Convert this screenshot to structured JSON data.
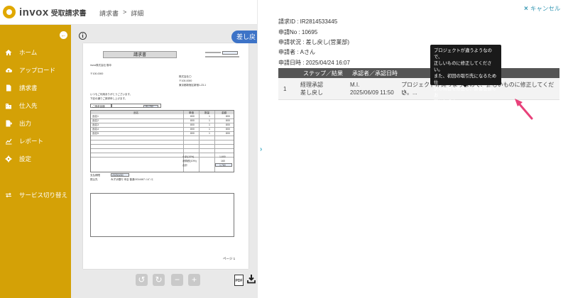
{
  "app": {
    "logo_text": "invox",
    "logo_sub": "受取請求書",
    "breadcrumb": [
      "請求書",
      ">",
      "詳細"
    ]
  },
  "sidebar": {
    "collapse_icon": "arrow-left-circle-icon",
    "items": [
      {
        "label": "ホーム",
        "icon": "home-icon"
      },
      {
        "label": "アップロード",
        "icon": "cloud-upload-icon"
      },
      {
        "label": "請求書",
        "icon": "document-icon"
      },
      {
        "label": "仕入先",
        "icon": "building-icon"
      },
      {
        "label": "出力",
        "icon": "export-icon"
      },
      {
        "label": "レポート",
        "icon": "chart-icon"
      },
      {
        "label": "設定",
        "icon": "gear-icon"
      },
      {
        "label": "サービス切り替え",
        "icon": "switch-icon"
      }
    ]
  },
  "viewer": {
    "return_button": "差し戻し",
    "document": {
      "title": "請求書",
      "recipient": "invox株式会社 御中",
      "postal": "〒100-0000",
      "greeting1": "いつもご利用ありがとうございます。",
      "greeting2": "下記の通りご請求申し上げます。",
      "amount_label": "ご請求金額",
      "amount_value": "¥1,760",
      "col_item": "品名",
      "col_price": "単価",
      "col_qty": "数量",
      "col_amount": "金額",
      "rows": [
        {
          "name": "品名1",
          "price": "800",
          "qty": "1",
          "amount": "800"
        },
        {
          "name": "品名2",
          "price": "800",
          "qty": "1",
          "amount": "800"
        },
        {
          "name": "品名3",
          "price": "800",
          "qty": "1",
          "amount": "800"
        },
        {
          "name": "品名4",
          "price": "800",
          "qty": "1",
          "amount": "800"
        },
        {
          "name": "品名5",
          "price": "800",
          "qty": "1",
          "amount": "800"
        }
      ],
      "subtotal_label": "小計(10%)",
      "subtotal_value": "1,600",
      "tax_label": "消費税(10%)",
      "tax_value": "160",
      "total_label": "合計",
      "total_value": "1,760",
      "due_label": "支払期限",
      "due_value": "2025/4/30",
      "bank_label": "振込先",
      "bank_value": "みずほ銀行 本店 普通 0014467 ｲﾝﾎﾞｲｽ",
      "page_label": "ページ 1",
      "issuer_name": "株式会社〇",
      "issuer_addr": "東京都新宿区新宿1-23-1"
    },
    "tools": [
      "rotate-left-icon",
      "rotate-right-icon",
      "zoom-out-icon",
      "zoom-in-icon"
    ],
    "pdf_label": "PDF",
    "download_icon": "download-icon"
  },
  "detail": {
    "cancel_label": "キャンセル",
    "invoice_id": "請求ID : IR2814533445",
    "request_no": "申請No : 10695",
    "status": "申請状況 : 差し戻し(営業部)",
    "requester": "申請者 : Aさん",
    "request_date": "申請日時 : 2025/04/24 16:07",
    "table": {
      "headers": [
        "ステップ／結果",
        "承認者／承認日時"
      ],
      "row": {
        "index": "1",
        "step": "経理承認",
        "result": "差し戻し",
        "approver": "M.I.",
        "datetime": "2025/06/09 11:50",
        "comment": "プロジェクトが違うようなので、正しいものに修正してくださ",
        "comment_more": "い。..."
      }
    },
    "tooltip": [
      "プロジェクトが違うようなので、",
      "正しいものに修正してください。",
      "また、初回の取引先になるため仕",
      "訳の科目を修正し、辞書登録もお",
      "願いします。"
    ]
  }
}
